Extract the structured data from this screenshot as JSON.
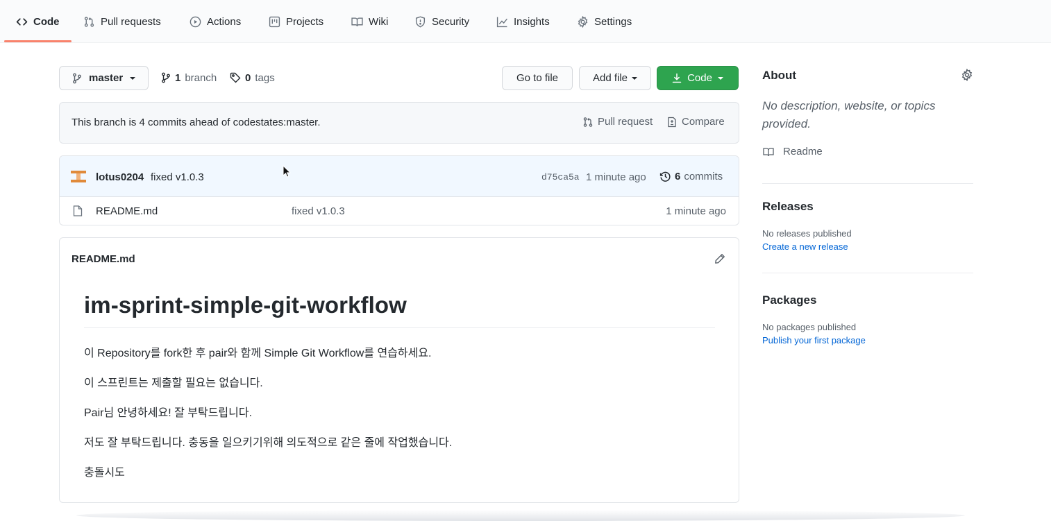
{
  "nav": {
    "tabs": [
      {
        "label": "Code",
        "icon": "code-icon",
        "active": true
      },
      {
        "label": "Pull requests",
        "icon": "git-pull-request-icon"
      },
      {
        "label": "Actions",
        "icon": "play-icon"
      },
      {
        "label": "Projects",
        "icon": "project-icon"
      },
      {
        "label": "Wiki",
        "icon": "book-icon"
      },
      {
        "label": "Security",
        "icon": "shield-icon"
      },
      {
        "label": "Insights",
        "icon": "graph-icon"
      },
      {
        "label": "Settings",
        "icon": "gear-icon"
      }
    ]
  },
  "toolbar": {
    "branch_select": "master",
    "branch_count": "1",
    "branch_label": "branch",
    "tag_count": "0",
    "tag_label": "tags",
    "go_to_file": "Go to file",
    "add_file": "Add file",
    "code": "Code"
  },
  "ahead": {
    "text": "This branch is 4 commits ahead of codestates:master.",
    "pull_request": "Pull request",
    "compare": "Compare"
  },
  "commit": {
    "author": "lotus0204",
    "message": "fixed v1.0.3",
    "sha": "d75ca5a",
    "time": "1 minute ago",
    "commit_count": "6",
    "commit_label": "commits"
  },
  "files": [
    {
      "name": "README.md",
      "message": "fixed v1.0.3",
      "time": "1 minute ago"
    }
  ],
  "readme": {
    "filename": "README.md",
    "title": "im-sprint-simple-git-workflow",
    "paragraphs": [
      "이 Repository를 fork한 후 pair와 함께 Simple Git Workflow를 연습하세요.",
      "이 스프린트는 제출할 필요는 없습니다.",
      "Pair님 안녕하세요! 잘 부탁드립니다.",
      "저도 잘 부탁드립니다. 충동을 일으키기위해 의도적으로 같은 줄에 작업했습니다.",
      "충돌시도"
    ]
  },
  "sidebar": {
    "about_title": "About",
    "about_desc": "No description, website, or topics provided.",
    "readme_link": "Readme",
    "releases_title": "Releases",
    "releases_none": "No releases published",
    "releases_link": "Create a new release",
    "packages_title": "Packages",
    "packages_none": "No packages published",
    "packages_link": "Publish your first package"
  },
  "colors": {
    "accent_underline": "#f9826c",
    "primary_green": "#2ea44f",
    "link_blue": "#0366d6",
    "commit_row_bg": "#f1f8ff",
    "avatar_orange": "#e08a3a"
  }
}
